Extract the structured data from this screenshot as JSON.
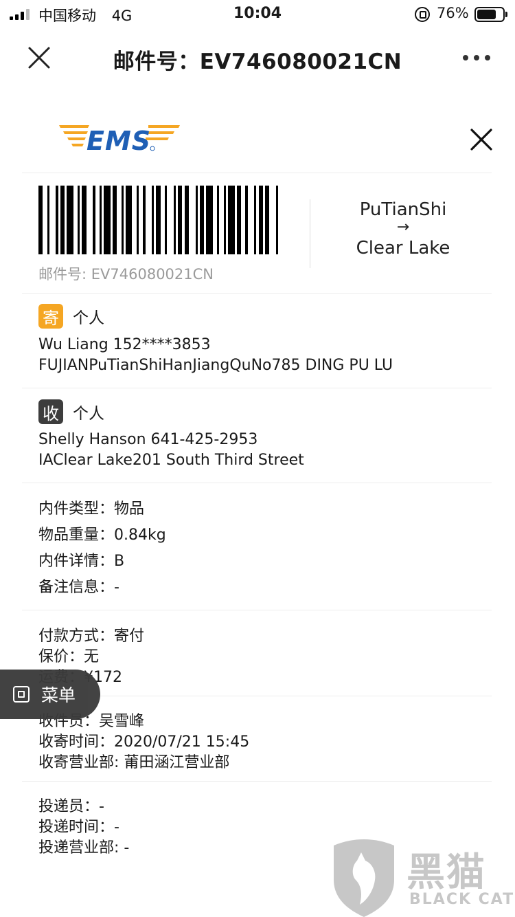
{
  "status_bar": {
    "carrier": "中国移动",
    "network": "4G",
    "time": "10:04",
    "battery": "76%",
    "battery_level": 0.76
  },
  "nav": {
    "title": "邮件号：EV746080021CN"
  },
  "card": {
    "logo": "EMS",
    "tracking_caption": "邮件号: EV746080021CN",
    "route": {
      "from": "PuTianShi",
      "arrow": "→",
      "to": "Clear Lake"
    },
    "sender": {
      "tag": "寄",
      "type": "个人",
      "name_phone": "Wu Liang 152****3853",
      "address": "FUJIANPuTianShiHanJiangQuNo785 DING PU LU"
    },
    "receiver": {
      "tag": "收",
      "type": "个人",
      "name_phone": "Shelly Hanson 641-425-2953",
      "address": "IAClear Lake201 South Third Street"
    },
    "item_info": [
      "内件类型：物品",
      "物品重量：0.84kg",
      "内件详情：B",
      "备注信息：-"
    ],
    "payment_info": [
      "付款方式：寄付",
      "保价：无",
      "运费：¥172"
    ],
    "collect_info": [
      "收件员：吴雪峰",
      "收寄时间：2020/07/21 15:45",
      "收寄营业部: 莆田涵江营业部"
    ],
    "delivery_info": [
      "投递员：-",
      "投递时间：-",
      "投递营业部: -"
    ]
  },
  "float_menu": {
    "label": "菜单"
  },
  "watermark": {
    "cn": "黑猫",
    "en": "BLACK CAT"
  },
  "colors": {
    "ems_orange": "#f5a623",
    "ems_blue": "#1f5fb5",
    "send_tag": "#f5a623",
    "receive_tag": "#3d3d3d"
  }
}
